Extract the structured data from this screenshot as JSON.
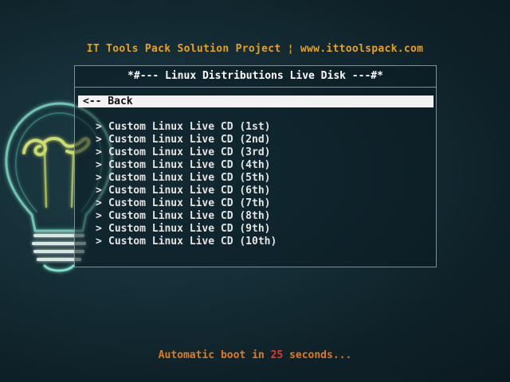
{
  "header": {
    "text": "IT Tools Pack Solution Project ¦ www.ittoolspack.com"
  },
  "menu": {
    "title": "*#--- Linux Distributions Live Disk ---#*",
    "back_label": "<-- Back",
    "chevron": ">",
    "items": [
      {
        "label": "Custom Linux Live CD (1st)"
      },
      {
        "label": "Custom Linux Live CD (2nd)"
      },
      {
        "label": "Custom Linux Live CD (3rd)"
      },
      {
        "label": "Custom Linux Live CD (4th)"
      },
      {
        "label": "Custom Linux Live CD (5th)"
      },
      {
        "label": "Custom Linux Live CD (6th)"
      },
      {
        "label": "Custom Linux Live CD (7th)"
      },
      {
        "label": "Custom Linux Live CD (8th)"
      },
      {
        "label": "Custom Linux Live CD (9th)"
      },
      {
        "label": "Custom Linux Live CD (10th)"
      }
    ]
  },
  "footer": {
    "prefix": "Automatic boot in ",
    "countdown": "25",
    "suffix": " seconds..."
  },
  "colors": {
    "header": "#e8a020",
    "footer": "#e07a1a",
    "countdown": "#e03a2a",
    "selected_bg": "#f2f2f2",
    "bulb_glow": "#7fe0c8"
  },
  "icons": {
    "background_art": "lightbulb-icon"
  }
}
